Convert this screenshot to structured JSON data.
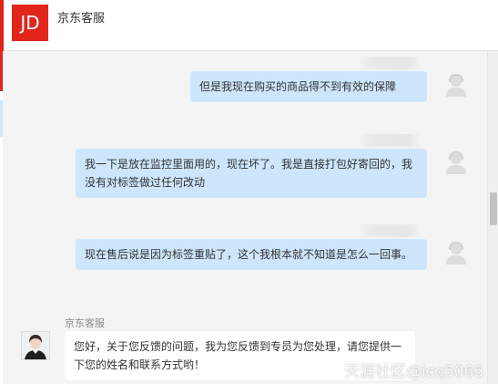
{
  "header": {
    "logo_text": "JD",
    "title": "京东客服",
    "brand_color": "#e1251b"
  },
  "messages": [
    {
      "sender": "user",
      "text": "但是我现在购买的商品得不到有效的保障"
    },
    {
      "sender": "user",
      "text": "我一下是放在监控里面用的，现在坏了。我是直接打包好寄回的，我没有对标签做过任何改动"
    },
    {
      "sender": "user",
      "text": "现在售后说是因为标签重贴了，这个我根本就不知道是怎么一回事。"
    },
    {
      "sender": "agent",
      "name": "京东客服",
      "text": "您好，关于您反馈的问题，我为您反馈到专员为您处理，请您提供一下您的姓名和联系方式哟！"
    }
  ],
  "watermark": "天涯社区@icq5066",
  "colors": {
    "user_bubble": "#cde6fb",
    "chat_background": "#f4f4f4",
    "agent_bubble": "#ffffff"
  },
  "icons": {
    "user_avatar": "user-silhouette-icon",
    "agent_avatar": "agent-photo-icon"
  }
}
